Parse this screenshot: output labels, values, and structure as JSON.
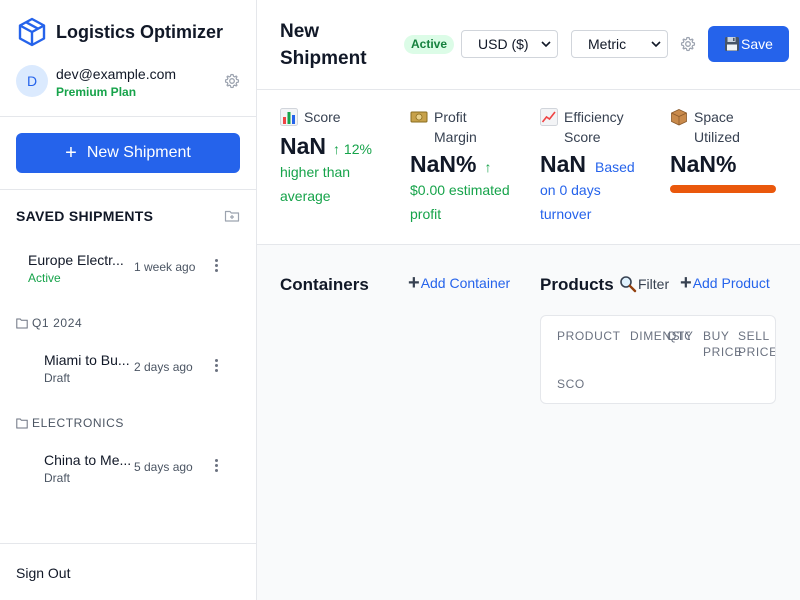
{
  "app": {
    "name": "Logistics Optimizer"
  },
  "user": {
    "initial": "D",
    "email": "dev@example.com",
    "plan": "Premium Plan"
  },
  "sidebar": {
    "new_shipment_label": "New Shipment",
    "saved_title": "SAVED SHIPMENTS",
    "ungrouped": [
      {
        "name": "Europe Electr...",
        "status": "Active",
        "time": "1 week ago"
      }
    ],
    "groups": [
      {
        "name": "Q1 2024",
        "items": [
          {
            "name": "Miami to Bu...",
            "status": "Draft",
            "time": "2 days ago"
          }
        ]
      },
      {
        "name": "ELECTRONICS",
        "items": [
          {
            "name": "China to Me...",
            "status": "Draft",
            "time": "5 days ago"
          }
        ]
      }
    ],
    "sign_out": "Sign Out"
  },
  "header": {
    "title": "New Shipment",
    "status": "Active",
    "currency": "USD ($)",
    "units": "Metric",
    "save_label": "Save"
  },
  "metrics": {
    "score": {
      "label": "Score",
      "value": "NaN",
      "delta": "↑ 12%",
      "line2": "higher than",
      "line3": "average"
    },
    "profit": {
      "label": "Profit Margin",
      "value": "NaN%",
      "arrow": "↑",
      "line2": "$0.00 estimated",
      "line3": "profit"
    },
    "efficiency": {
      "label": "Efficiency Score",
      "value": "NaN",
      "sub1": "Based",
      "line2": "on 0 days",
      "line3": "turnover"
    },
    "space": {
      "label": "Space Utilized",
      "value": "NaN%",
      "fill": 1.0,
      "color": "#ea580c"
    }
  },
  "containers": {
    "title": "Containers",
    "add_label": "Add Container"
  },
  "products": {
    "title": "Products",
    "filter_label": "Filter",
    "add_label": "Add Product",
    "columns": [
      "PRODUCT",
      "DIMENSIONS",
      "QTY",
      "BUY PRICE",
      "SELL PRICE",
      "SCO"
    ]
  },
  "colors": {
    "accent": "#2563eb",
    "success": "#16a34a",
    "warning": "#ea580c"
  }
}
